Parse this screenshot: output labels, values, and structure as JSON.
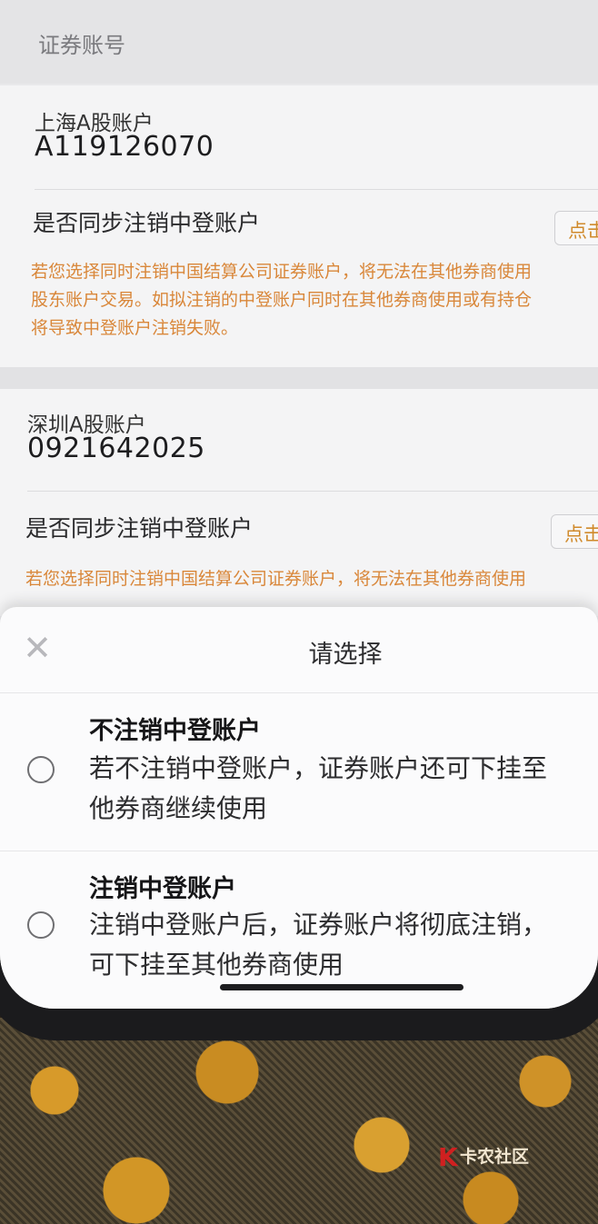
{
  "section": {
    "title": "证券账号"
  },
  "accounts": [
    {
      "label": "上海A股账户",
      "number": "A119126070",
      "sync_label": "是否同步注销中登账户",
      "button": "点击",
      "warning": [
        "若您选择同时注销中国结算公司证券账户，将无法在其他券商使用",
        "股东账户交易。如拟注销的中登账户同时在其他券商使用或有持仓",
        "将导致中登账户注销失败。"
      ]
    },
    {
      "label": "深圳A股账户",
      "number": "0921642025",
      "sync_label": "是否同步注销中登账户",
      "button": "点击",
      "warning": [
        "若您选择同时注销中国结算公司证券账户，将无法在其他券商使用"
      ]
    }
  ],
  "sheet": {
    "close_icon": "close-icon",
    "title": "请选择",
    "options": [
      {
        "title": "不注销中登账户",
        "desc": [
          "若不注销中登账户，证券账户还可下挂至",
          "他券商继续使用"
        ]
      },
      {
        "title": "注销中登账户",
        "desc": [
          "注销中登账户后，证券账户将彻底注销，",
          "可下挂至其他券商使用"
        ]
      }
    ]
  },
  "watermark": {
    "text": "卡农社区",
    "logo": "K"
  },
  "colors": {
    "accent": "#d9873a",
    "screen_bg": "#e9e9eb"
  }
}
